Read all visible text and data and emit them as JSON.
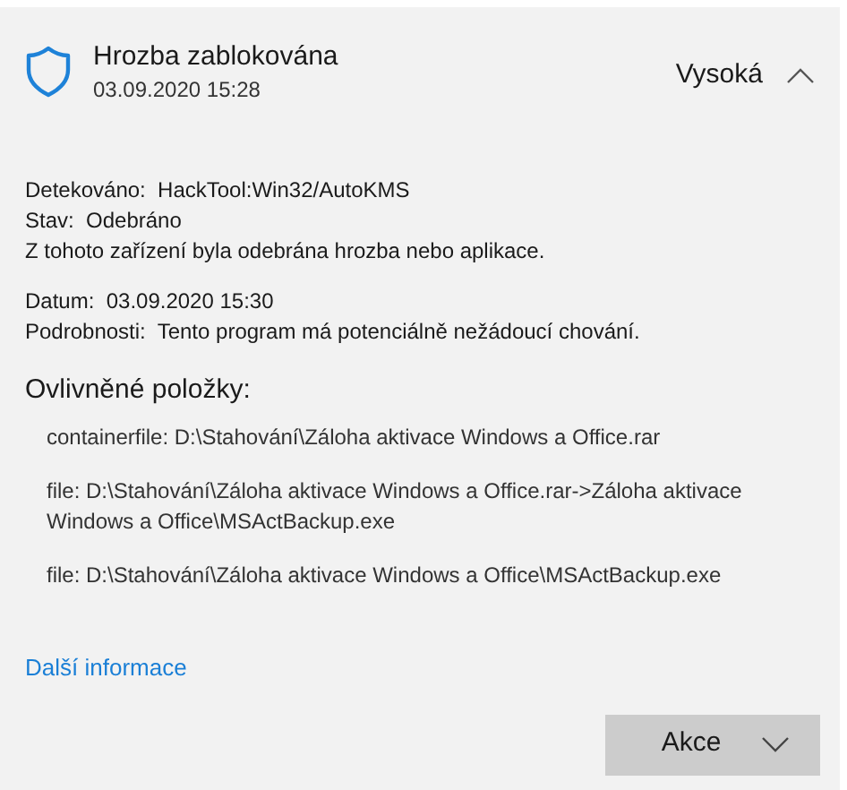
{
  "header": {
    "title": "Hrozba zablokována",
    "date": "03.09.2020 15:28",
    "severity": "Vysoká",
    "expanded": true
  },
  "details": [
    [
      "Detekováno:  HackTool:Win32/AutoKMS",
      "Stav:  Odebráno",
      "Z tohoto zařízení byla odebrána hrozba nebo aplikace."
    ],
    [
      "Datum:  03.09.2020 15:30",
      "Podrobnosti:  Tento program má potenciálně nežádoucí chování."
    ]
  ],
  "affected": {
    "heading": "Ovlivněné položky:",
    "items": [
      "containerfile: D:\\Stahování\\Záloha aktivace Windows a Office.rar",
      "file: D:\\Stahování\\Záloha aktivace Windows a Office.rar->Záloha aktivace Windows a Office\\MSActBackup.exe",
      "file: D:\\Stahování\\Záloha aktivace Windows a Office\\MSActBackup.exe"
    ]
  },
  "link": "Další informace",
  "action_button": "Akce"
}
